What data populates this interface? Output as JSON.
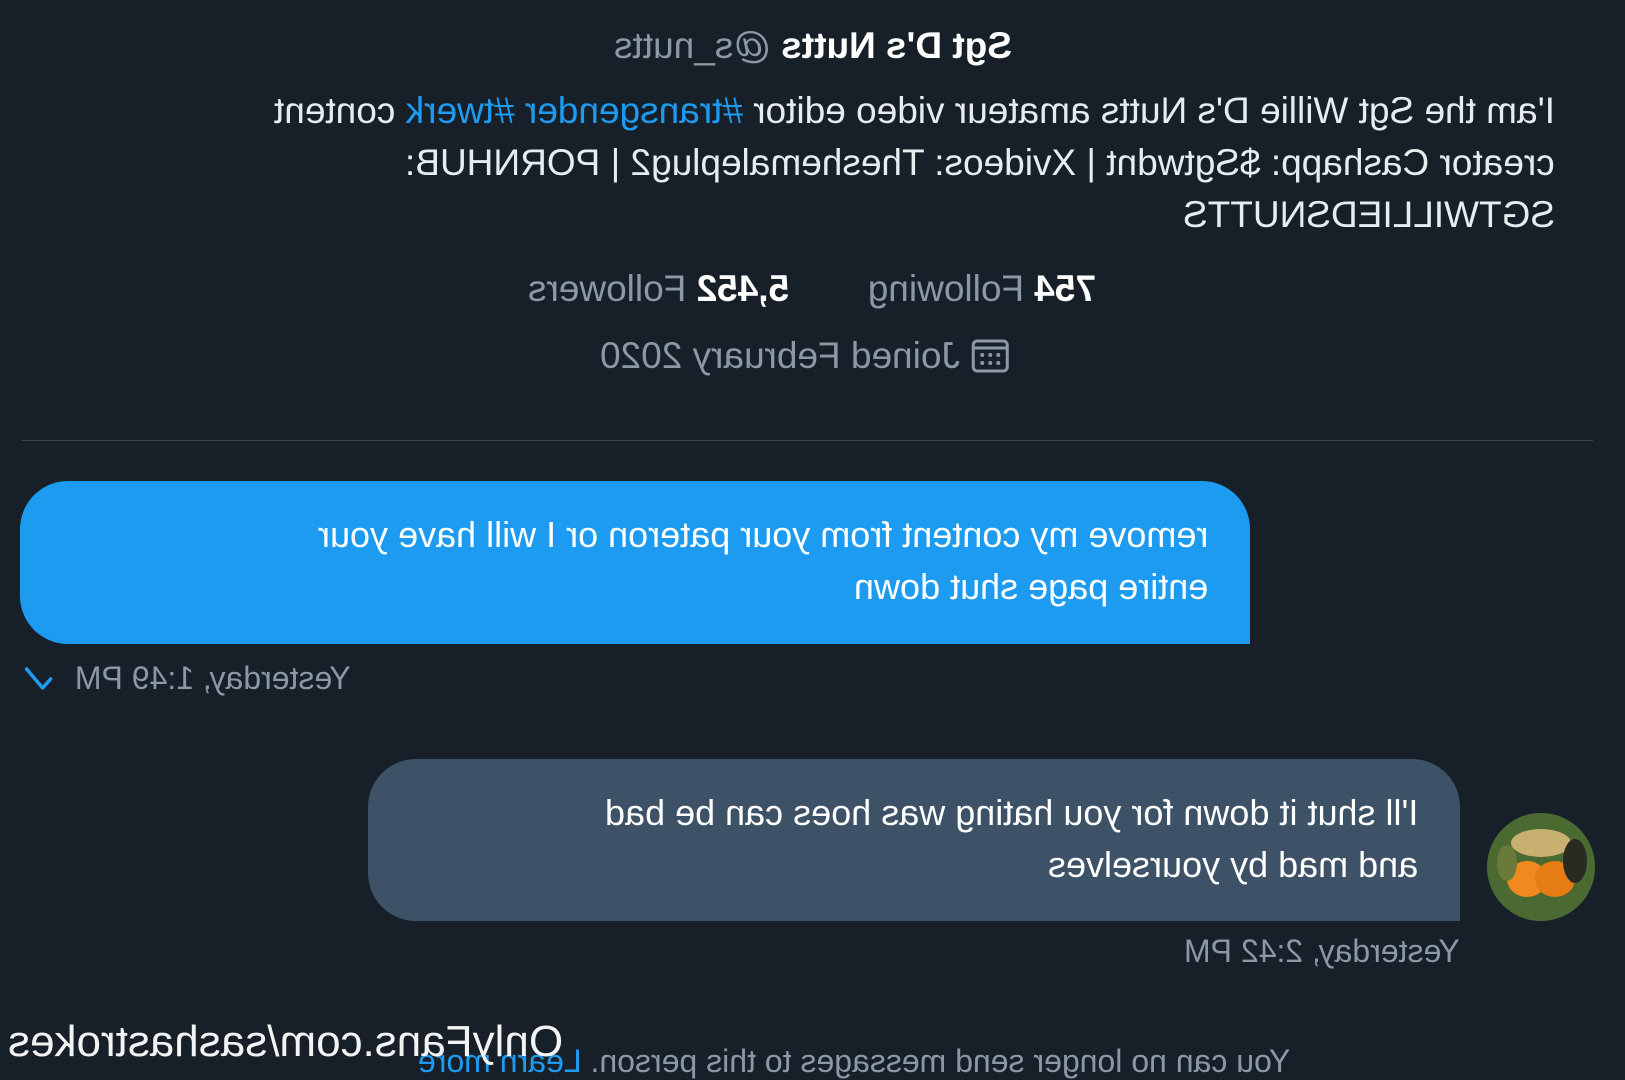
{
  "profile": {
    "display_name": "Sgt D's Nutts",
    "handle": "@s_nutts",
    "bio": {
      "line1_prefix": "I'am the Sgt Willie D's Nutts amateur video editor ",
      "line1_tags": "#transgender #twerk",
      "line1_suffix": " content",
      "line2": "creator Cashapp: $Sgtwdnt | Xvideos: Theshemaleplug2 | PORNHUB:",
      "line3": "SGTWILLIEDSNUTTS"
    },
    "following_count": "754",
    "following_label": "Following",
    "followers_count": "5,452",
    "followers_label": "Followers",
    "joined": "Joined February 2020",
    "calendar_icon": "calendar-icon"
  },
  "messages": [
    {
      "line1": "remove my content from your pateron or I will have your",
      "line2": "entire page shut down",
      "time": "Yesterday, 1:49 PM",
      "status_icon": "check-icon",
      "color": "#1d9bf0"
    },
    {
      "line1": "I'll shut it down for you hating was hoes can be bad",
      "line2": "and mad by yourselves",
      "time": "Yesterday, 2:42 PM",
      "color": "#3d5266"
    }
  ],
  "footer": {
    "notice": "You can no longer send messages to this person.",
    "learn_more": "Learn more"
  },
  "watermark": "OnlyFans.com/sashastrokes"
}
